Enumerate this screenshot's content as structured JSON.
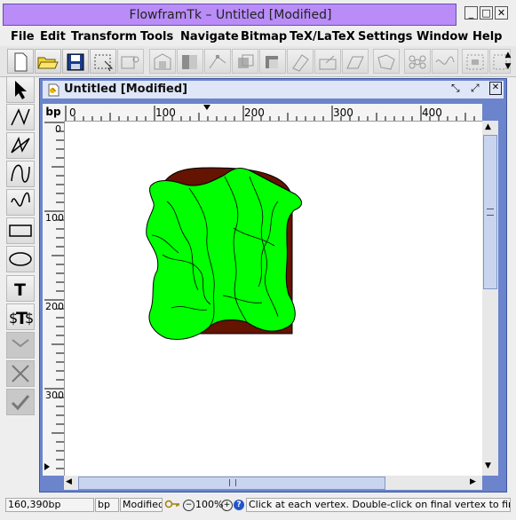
{
  "window": {
    "title": "FlowframTk – Untitled [Modified]"
  },
  "menu": [
    "File",
    "Edit",
    "Transform",
    "Tools",
    "Navigate",
    "Bitmap",
    "TeX/LaTeX",
    "Settings",
    "Window",
    "Help"
  ],
  "document": {
    "title": "Untitled [Modified]"
  },
  "ruler": {
    "unit": "bp",
    "h_ticks": [
      "0",
      "100",
      "200",
      "300",
      "400"
    ],
    "v_ticks": [
      "0",
      "100",
      "200",
      "300"
    ]
  },
  "status": {
    "position": "160,390bp",
    "unit": "bp",
    "modified": "Modified",
    "zoom": "100%",
    "message": "Click at each vertex. Double-click on final vertex to finish pat"
  },
  "colors": {
    "accent": "#b98cf7",
    "frame": "#6b84cc",
    "shape_fill": "#00ff00",
    "background_shape": "#641400"
  },
  "icons": [
    "new-file-icon",
    "open-folder-icon",
    "save-icon",
    "select-icon",
    "arrow-icon",
    "line-icon",
    "polygon-icon",
    "curve-icon",
    "wave-icon",
    "rectangle-icon",
    "ellipse-icon",
    "text-icon",
    "math-text-icon"
  ]
}
